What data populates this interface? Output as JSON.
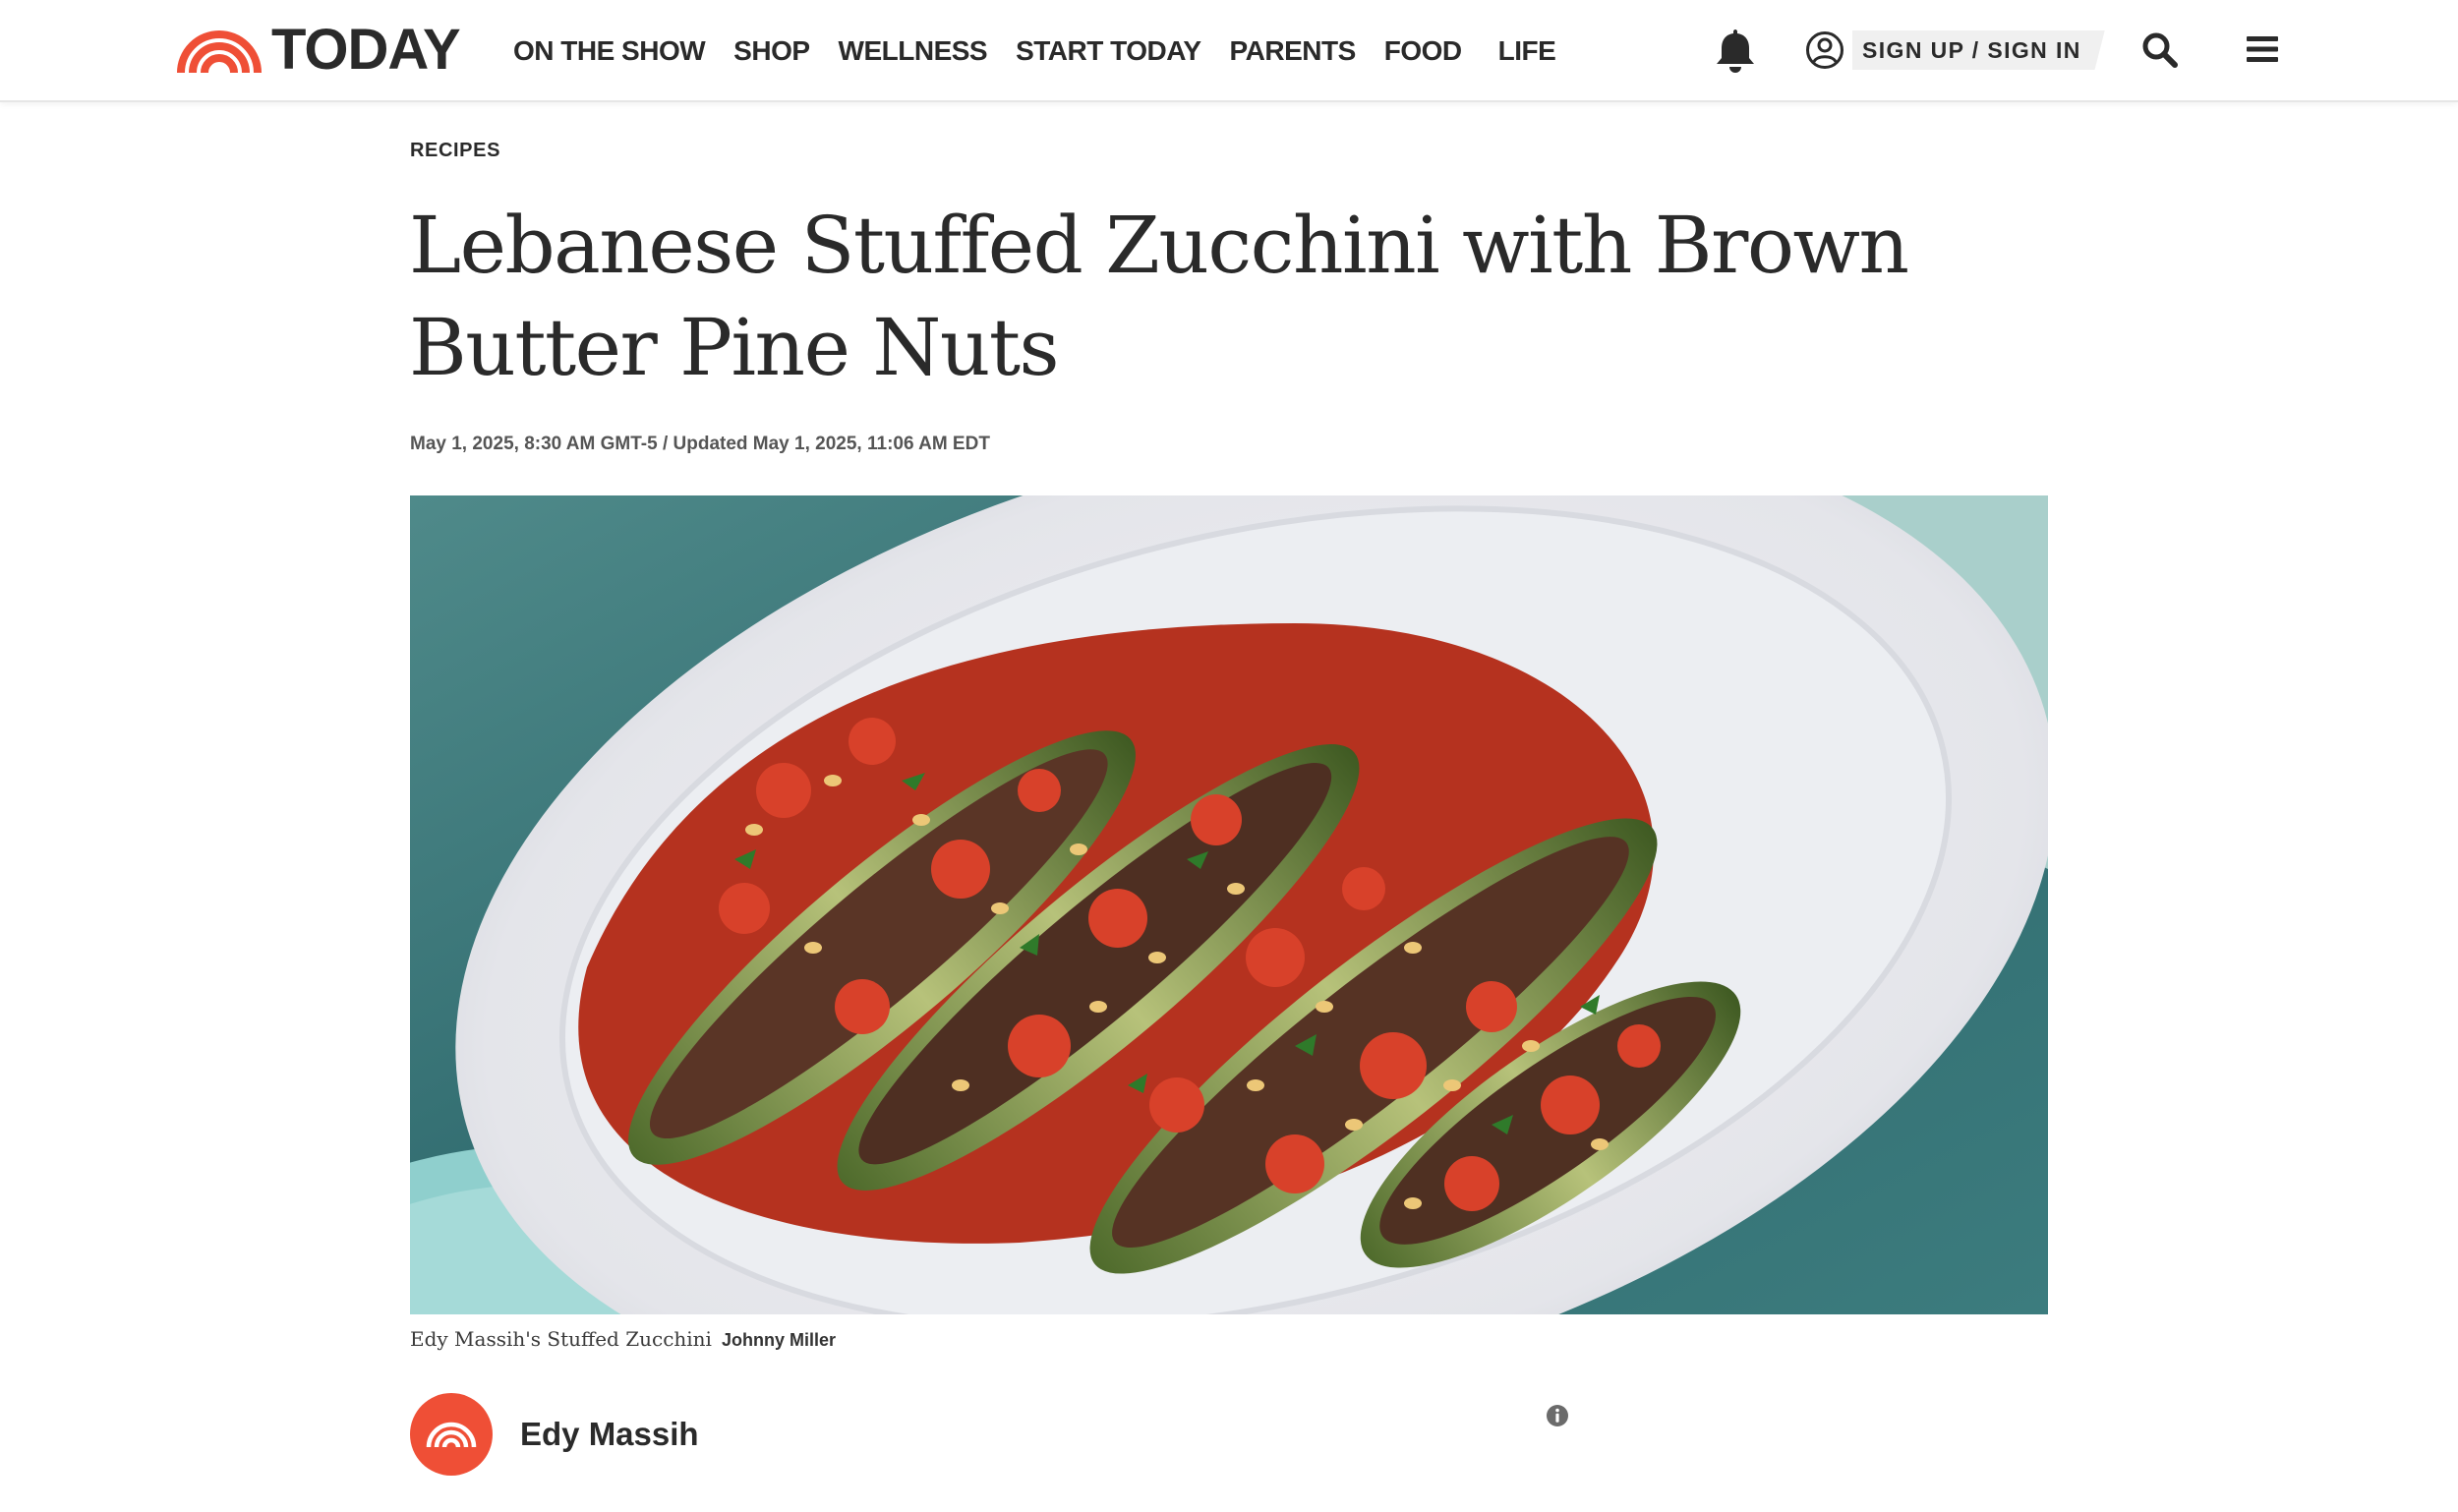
{
  "brand": {
    "logo_text": "TODAY",
    "accent": "#ef4f36",
    "icon": "today-rainbow-logo"
  },
  "nav": {
    "items": [
      {
        "label": "ON THE SHOW"
      },
      {
        "label": "SHOP"
      },
      {
        "label": "WELLNESS"
      },
      {
        "label": "START TODAY"
      },
      {
        "label": "PARENTS"
      },
      {
        "label": "FOOD"
      },
      {
        "label": "LIFE"
      }
    ]
  },
  "header_actions": {
    "notifications_icon": "bell-icon",
    "signin_label": "SIGN UP / SIGN IN",
    "search_icon": "search-icon",
    "menu_icon": "hamburger-menu-icon"
  },
  "article": {
    "category": "RECIPES",
    "title": "Lebanese Stuffed Zucchini with Brown Butter Pine Nuts",
    "dateline": "May 1, 2025, 8:30 AM GMT-5 / Updated May 1, 2025, 11:06 AM EDT",
    "image": {
      "caption": "Edy Massih's Stuffed Zucchini",
      "credit": "Johnny Miller"
    },
    "author": {
      "name": "Edy Massih"
    }
  }
}
